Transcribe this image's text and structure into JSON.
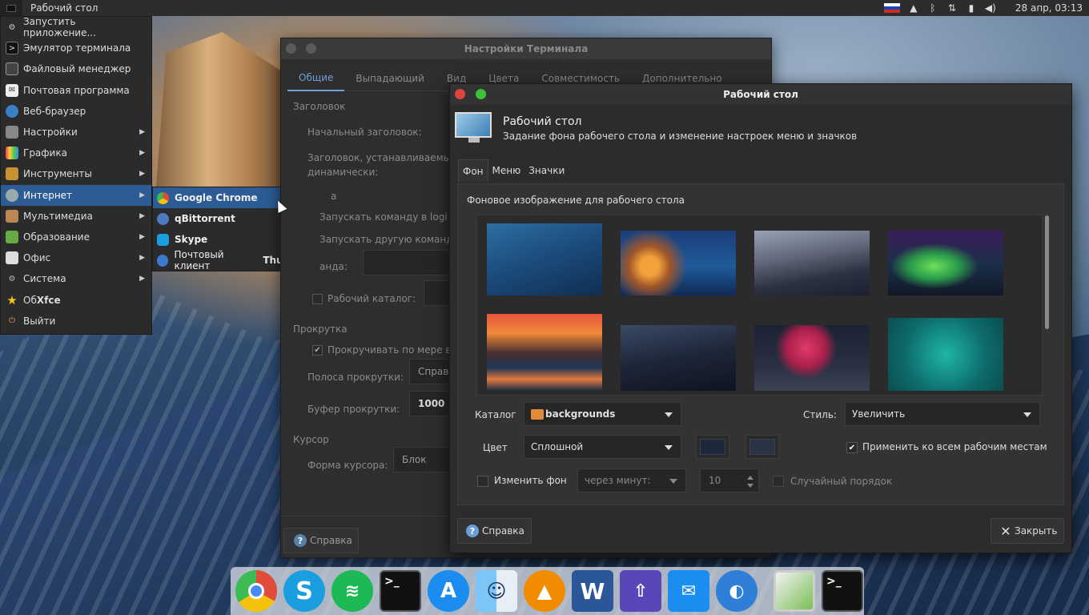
{
  "top_panel": {
    "window_title": "Рабочий стол",
    "clock": "28 апр, 03:13",
    "icons": [
      "ru-flag-icon",
      "bell-icon",
      "bluetooth-icon",
      "network-icon",
      "battery-icon",
      "volume-icon"
    ]
  },
  "app_menu": {
    "items": [
      {
        "label": "Запустить приложение...",
        "icon": "gears-icon"
      },
      {
        "label": "Эмулятор терминала",
        "icon": "terminal-icon"
      },
      {
        "label": "Файловый менеджер",
        "icon": "folder-icon"
      },
      {
        "label": "Почтовая программа",
        "icon": "mail-icon"
      },
      {
        "label": "Веб-браузер",
        "icon": "globe-icon"
      },
      {
        "label": "Настройки",
        "icon": "settings-icon",
        "submenu": true
      },
      {
        "label": "Графика",
        "icon": "graphics-icon",
        "submenu": true
      },
      {
        "label": "Инструменты",
        "icon": "tools-icon",
        "submenu": true
      },
      {
        "label": "Интернет",
        "icon": "internet-icon",
        "submenu": true,
        "selected": true
      },
      {
        "label": "Мультимедиа",
        "icon": "multimedia-icon",
        "submenu": true
      },
      {
        "label": "Образование",
        "icon": "education-icon",
        "submenu": true
      },
      {
        "label": "Офис",
        "icon": "office-icon",
        "submenu": true
      },
      {
        "label": "Система",
        "icon": "system-icon",
        "submenu": true
      },
      {
        "label_prefix": "Об ",
        "label_bold": "Xfce",
        "icon": "star-icon"
      },
      {
        "label": "Выйти",
        "icon": "logout-icon"
      }
    ],
    "internet_submenu": [
      {
        "label": "Google Chrome",
        "icon": "chrome-icon",
        "color": "#e04b3a"
      },
      {
        "label": "qBittorrent",
        "icon": "qbittorrent-icon",
        "color": "#4d7bbf"
      },
      {
        "label": "Skype",
        "icon": "skype-icon",
        "color": "#1a9ee0"
      },
      {
        "prefix": "Почтовый клиент ",
        "label": "Thunderbird",
        "icon": "thunderbird-icon",
        "color": "#3c7ad1"
      }
    ]
  },
  "terminal_settings": {
    "title": "Настройки Терминала",
    "tabs": [
      "Общие",
      "Выпадающий",
      "Вид",
      "Цвета",
      "Совместимость",
      "Дополнительно"
    ],
    "section_title": "Заголовок",
    "initial_title_label": "Начальный заголовок:",
    "dynamic_title_label_1": "Заголовок, устанавливаемый",
    "dynamic_title_label_2": "динамически:",
    "section_command_partial": "а",
    "run_login_partial": "Запускать команду в logi",
    "run_other_partial": "Запускать другую команд",
    "command_partial": "анда:",
    "workdir_label": "Рабочий каталог:",
    "scroll_section": "Прокрутка",
    "scroll_on_output_partial": "Прокручивать по мере вы",
    "scrollbar_label": "Полоса прокрутки:",
    "scrollbar_value_partial": "Справа",
    "buffer_label": "Буфер прокрутки:",
    "buffer_value": "1000",
    "cursor_section": "Курсор",
    "cursor_shape_label": "Форма курсора:",
    "cursor_shape_value": "Блок",
    "help_button": "Справка"
  },
  "desktop_settings": {
    "title": "Рабочий стол",
    "header_title": "Рабочий стол",
    "header_subtitle": "Задание фона рабочего стола и изменение настроек меню и значков",
    "tabs": [
      "Фон",
      "Меню",
      "Значки"
    ],
    "bg_label": "Фоновое изображение для рабочего стола",
    "thumbnails": [
      "aurora-blue",
      "coastal-town-night",
      "desert-dunes",
      "northern-lights",
      "mountain-lake-sunset",
      "starry-sky",
      "pink-tree",
      "teal-circle"
    ],
    "catalog_label": "Каталог",
    "catalog_value": "backgrounds",
    "style_label": "Стиль:",
    "style_value": "Увеличить",
    "color_label": "Цвет",
    "color_value": "Сплошной",
    "apply_all_label": "Применить ко всем рабочим местам",
    "apply_all_checked": true,
    "change_bg_label": "Изменить фон",
    "interval_value": "через минут:",
    "interval_number": "10",
    "random_order_label": "Случайный порядок",
    "help_button": "Справка",
    "close_button": "Закрыть",
    "colors": {
      "close_dot": "#e0443e",
      "max_dot": "#3cc13c"
    }
  },
  "dock": {
    "apps": [
      "chrome-icon",
      "skype-icon",
      "spotify-icon",
      "terminal-icon",
      "app-store-icon",
      "finder-icon",
      "vlc-icon",
      "word-icon",
      "unknown-app-icon",
      "mail-bird-icon",
      "eagle-icon",
      "desktop-settings-icon",
      "terminal-icon-2"
    ]
  }
}
